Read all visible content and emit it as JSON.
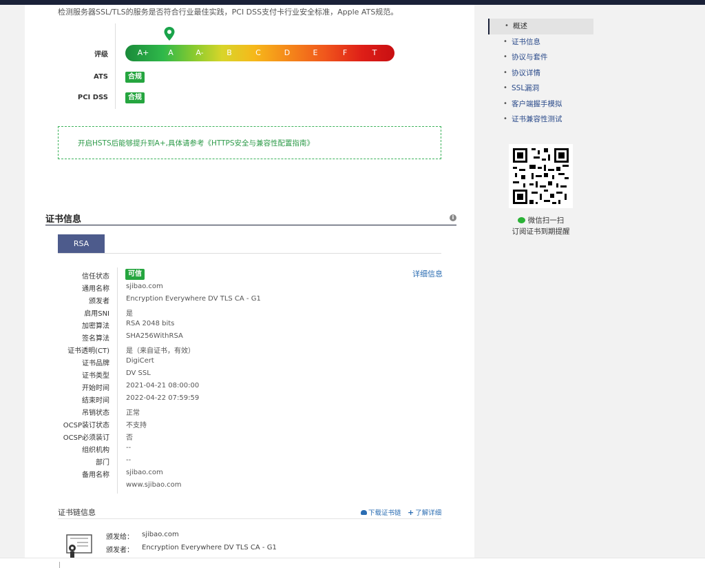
{
  "intro_text": "检测服务器SSL/TLS的服务是否符合行业最佳实践，PCI DSS支付卡行业安全标准，Apple ATS规范。",
  "rating": {
    "label": "评级",
    "grades": [
      "A+",
      "A",
      "A-",
      "B",
      "C",
      "D",
      "E",
      "F",
      "T"
    ],
    "current": "A",
    "ats_label": "ATS",
    "ats_value": "合规",
    "pci_label": "PCI DSS",
    "pci_value": "合规"
  },
  "tip": "开启HSTS后能够提升到A+,具体请参考《HTTPS安全与兼容性配置指南》",
  "cert_section": {
    "title": "证书信息",
    "tab": "RSA",
    "more_link": "详细信息",
    "rows": [
      {
        "label": "信任状态",
        "value": "可信"
      },
      {
        "label": "通用名称",
        "value": "sjibao.com"
      },
      {
        "label": "颁发者",
        "value": "Encryption Everywhere DV TLS CA - G1"
      },
      {
        "label": "启用SNI",
        "value": "是"
      },
      {
        "label": "加密算法",
        "value": "RSA 2048 bits"
      },
      {
        "label": "签名算法",
        "value": "SHA256WithRSA"
      },
      {
        "label": "证书透明(CT)",
        "value": "是（来自证书，有效）"
      },
      {
        "label": "证书品牌",
        "value": "DigiCert"
      },
      {
        "label": "证书类型",
        "value": "DV SSL"
      },
      {
        "label": "开始时间",
        "value": "2021-04-21 08:00:00"
      },
      {
        "label": "结束时间",
        "value": "2022-04-22 07:59:59"
      },
      {
        "label": "吊销状态",
        "value": "正常"
      },
      {
        "label": "OCSP装订状态",
        "value": "不支持"
      },
      {
        "label": "OCSP必须装订",
        "value": "否"
      },
      {
        "label": "组织机构",
        "value": "--"
      },
      {
        "label": "部门",
        "value": "--"
      },
      {
        "label": "备用名称",
        "value": "sjibao.com"
      }
    ],
    "alt_name_extra": "www.sjibao.com"
  },
  "chain": {
    "title": "证书链信息",
    "download": "下载证书链",
    "learn_more": "了解详细",
    "issued_to_label": "颁发给：",
    "issued_to": "sjibao.com",
    "issuer_label": "颁发者：",
    "issuer": "Encryption Everywhere DV TLS CA - G1"
  },
  "sidebar": {
    "items": [
      {
        "label": "概述",
        "active": true
      },
      {
        "label": "证书信息"
      },
      {
        "label": "协议与套件"
      },
      {
        "label": "协议详情"
      },
      {
        "label": "SSL漏洞"
      },
      {
        "label": "客户端握手模拟"
      },
      {
        "label": "证书兼容性测试"
      }
    ],
    "qr_caption1": "微信扫一扫",
    "qr_caption2": "订阅证书到期提醒"
  },
  "colors": {
    "accent": "#4d5b8c",
    "success": "#25a53f",
    "link": "#2a6cb2",
    "nav_dark": "#1a2138"
  }
}
